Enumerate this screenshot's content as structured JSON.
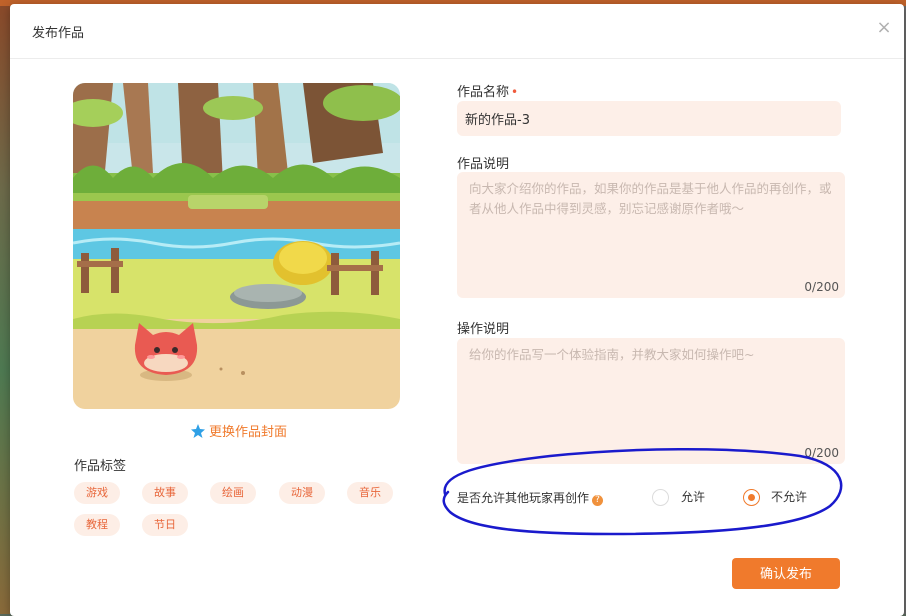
{
  "dialog": {
    "title": "发布作品",
    "close_glyph": "×",
    "close_icon": "close-icon"
  },
  "cover": {
    "change_label": "更换作品封面",
    "change_icon": "star-icon",
    "image_description_icon": "game-scene-cover-image"
  },
  "tags": {
    "label": "作品标签",
    "items": [
      "游戏",
      "故事",
      "绘画",
      "动漫",
      "音乐",
      "教程",
      "节日"
    ]
  },
  "form": {
    "name_label": "作品名称",
    "required_mark": "•",
    "name_value": "新的作品-3",
    "description_label": "作品说明",
    "description_placeholder": "向大家介绍你的作品，如果你的作品是基于他人作品的再创作，或者从他人作品中得到灵感，别忘记感谢原作者哦～",
    "description_counter": "0/200",
    "operation_label": "操作说明",
    "operation_placeholder": "给你的作品写一个体验指南，并教大家如何操作吧~",
    "operation_counter": "0/200",
    "allow_remix_label": "是否允许其他玩家再创作",
    "help_glyph": "?",
    "options": [
      "允许",
      "不允许"
    ],
    "selected_option": "不允许"
  },
  "submit_label": "确认发布",
  "colors": {
    "accent": "#f07a2c",
    "field_bg": "#fdefe8",
    "tag_bg": "#fdeee6",
    "annotation_stroke": "#1a1acc"
  }
}
